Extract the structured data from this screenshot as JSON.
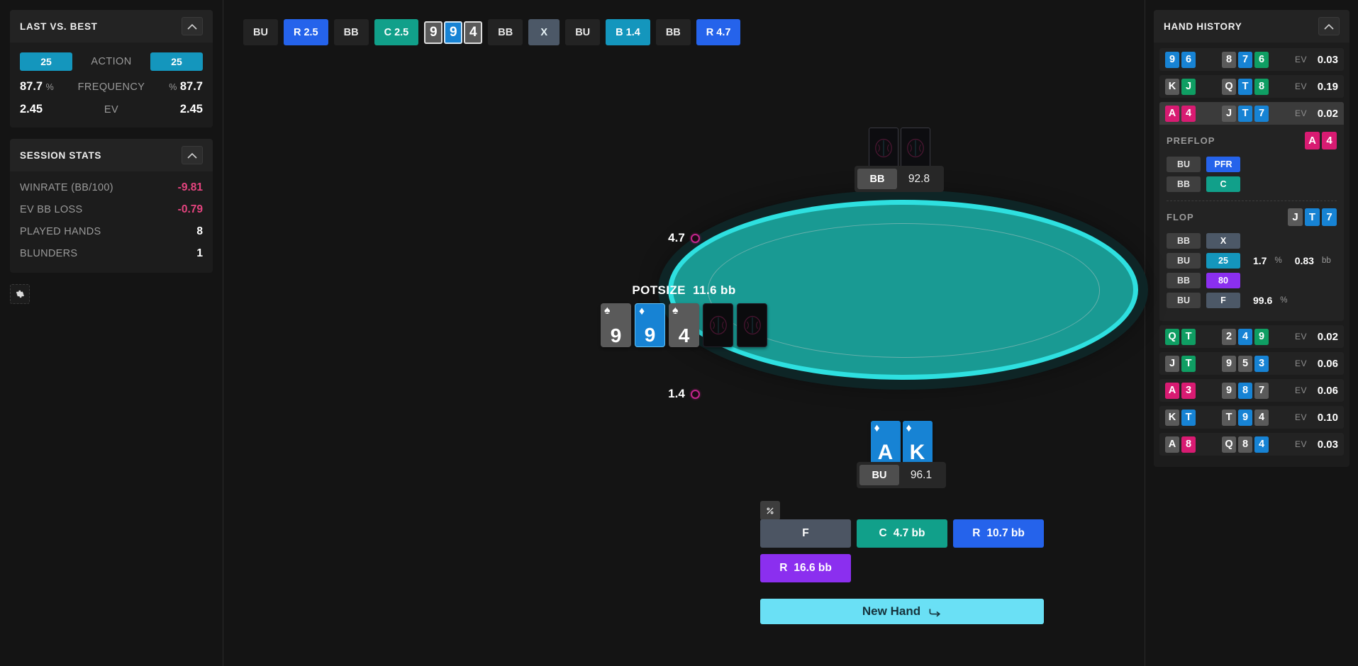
{
  "left_sidebar": {
    "last_vs_best": {
      "title": "LAST VS. BEST",
      "collapse_icon": "chevron-up-icon",
      "action_label": "ACTION",
      "action_left": "25",
      "action_right": "25",
      "frequency_label": "FREQUENCY",
      "frequency_left": "87.7",
      "frequency_left_unit": "%",
      "frequency_right": "87.7",
      "frequency_right_unit": "%",
      "ev_label": "EV",
      "ev_left": "2.45",
      "ev_right": "2.45"
    },
    "session_stats": {
      "title": "SESSION STATS",
      "collapse_icon": "chevron-up-icon",
      "rows": [
        {
          "label": "WINRATE (BB/100)",
          "value": "-9.81",
          "negative": true
        },
        {
          "label": "EV BB LOSS",
          "value": "-0.79",
          "negative": true
        },
        {
          "label": "PLAYED HANDS",
          "value": "8",
          "negative": false
        },
        {
          "label": "BLUNDERS",
          "value": "1",
          "negative": false
        }
      ]
    },
    "settings_icon": "gear-icon"
  },
  "action_strip": [
    {
      "kind": "pos",
      "label": "BU"
    },
    {
      "kind": "raise",
      "label": "R 2.5"
    },
    {
      "kind": "pos",
      "label": "BB"
    },
    {
      "kind": "call",
      "label": "C 2.5"
    },
    {
      "kind": "cards",
      "cards": [
        {
          "rank": "9",
          "suit": "s"
        },
        {
          "rank": "9",
          "suit": "d"
        },
        {
          "rank": "4",
          "suit": "s"
        }
      ]
    },
    {
      "kind": "pos",
      "label": "BB"
    },
    {
      "kind": "check",
      "label": "X"
    },
    {
      "kind": "pos",
      "label": "BU"
    },
    {
      "kind": "bet",
      "label": "B 1.4"
    },
    {
      "kind": "pos",
      "label": "BB"
    },
    {
      "kind": "raise",
      "label": "R 4.7"
    }
  ],
  "table": {
    "potsize_label": "POTSIZE",
    "potsize_value": "11.6 bb",
    "board": [
      {
        "rank": "9",
        "suit": "s",
        "facedown": false
      },
      {
        "rank": "9",
        "suit": "d",
        "facedown": false
      },
      {
        "rank": "4",
        "suit": "s",
        "facedown": false
      },
      {
        "rank": "",
        "suit": "",
        "facedown": true
      },
      {
        "rank": "",
        "suit": "",
        "facedown": true
      }
    ],
    "bet_top": "4.7",
    "bet_bottom": "1.4",
    "chip_color": "#c3248c",
    "felt_color": "#199a93",
    "rail_color": "#2ee0e0",
    "opponent": {
      "position": "BB",
      "stack": "92.8",
      "cards_facedown": true
    },
    "hero": {
      "position": "BU",
      "stack": "96.1",
      "cards": [
        {
          "rank": "A",
          "suit": "d"
        },
        {
          "rank": "K",
          "suit": "d"
        }
      ]
    }
  },
  "action_buttons": {
    "pct_toggle_label": "%",
    "pct_toggle_icon": "percent-icon",
    "row1": [
      {
        "action": "F",
        "amount": "",
        "style": "fold"
      },
      {
        "action": "C",
        "amount": "4.7 bb",
        "style": "call"
      },
      {
        "action": "R",
        "amount": "10.7 bb",
        "style": "raise"
      }
    ],
    "row2": [
      {
        "action": "R",
        "amount": "16.6 bb",
        "style": "allin"
      }
    ],
    "new_hand_label": "New Hand",
    "new_hand_icon": "redo-arrow-icon"
  },
  "hand_history": {
    "title": "HAND HISTORY",
    "collapse_icon": "chevron-up-icon",
    "ev_label": "EV",
    "rows": [
      {
        "hole": [
          {
            "rank": "9",
            "suit": "d"
          },
          {
            "rank": "6",
            "suit": "d"
          }
        ],
        "board": [
          {
            "rank": "8",
            "suit": "s"
          },
          {
            "rank": "7",
            "suit": "d"
          },
          {
            "rank": "6",
            "suit": "c"
          }
        ],
        "ev": "0.03",
        "active": false
      },
      {
        "hole": [
          {
            "rank": "K",
            "suit": "s"
          },
          {
            "rank": "J",
            "suit": "c"
          }
        ],
        "board": [
          {
            "rank": "Q",
            "suit": "s"
          },
          {
            "rank": "T",
            "suit": "d"
          },
          {
            "rank": "8",
            "suit": "c"
          }
        ],
        "ev": "0.19",
        "active": false
      },
      {
        "hole": [
          {
            "rank": "A",
            "suit": "h"
          },
          {
            "rank": "4",
            "suit": "h"
          }
        ],
        "board": [
          {
            "rank": "J",
            "suit": "s"
          },
          {
            "rank": "T",
            "suit": "d"
          },
          {
            "rank": "7",
            "suit": "d"
          }
        ],
        "ev": "0.02",
        "active": true
      },
      {
        "hole": [
          {
            "rank": "Q",
            "suit": "c"
          },
          {
            "rank": "T",
            "suit": "c"
          }
        ],
        "board": [
          {
            "rank": "2",
            "suit": "s"
          },
          {
            "rank": "4",
            "suit": "d"
          },
          {
            "rank": "9",
            "suit": "c"
          }
        ],
        "ev": "0.02",
        "active": false
      },
      {
        "hole": [
          {
            "rank": "J",
            "suit": "s"
          },
          {
            "rank": "T",
            "suit": "c"
          }
        ],
        "board": [
          {
            "rank": "9",
            "suit": "s"
          },
          {
            "rank": "5",
            "suit": "s"
          },
          {
            "rank": "3",
            "suit": "d"
          }
        ],
        "ev": "0.06",
        "active": false
      },
      {
        "hole": [
          {
            "rank": "A",
            "suit": "h"
          },
          {
            "rank": "3",
            "suit": "h"
          }
        ],
        "board": [
          {
            "rank": "9",
            "suit": "s"
          },
          {
            "rank": "8",
            "suit": "d"
          },
          {
            "rank": "7",
            "suit": "s"
          }
        ],
        "ev": "0.06",
        "active": false
      },
      {
        "hole": [
          {
            "rank": "K",
            "suit": "s"
          },
          {
            "rank": "T",
            "suit": "d"
          }
        ],
        "board": [
          {
            "rank": "T",
            "suit": "s"
          },
          {
            "rank": "9",
            "suit": "d"
          },
          {
            "rank": "4",
            "suit": "s"
          }
        ],
        "ev": "0.10",
        "active": false
      },
      {
        "hole": [
          {
            "rank": "A",
            "suit": "s"
          },
          {
            "rank": "8",
            "suit": "h"
          }
        ],
        "board": [
          {
            "rank": "Q",
            "suit": "s"
          },
          {
            "rank": "8",
            "suit": "s"
          },
          {
            "rank": "4",
            "suit": "d"
          }
        ],
        "ev": "0.03",
        "active": false
      }
    ],
    "detail": {
      "streets": [
        {
          "name": "PREFLOP",
          "cards": [
            {
              "rank": "A",
              "suit": "h"
            },
            {
              "rank": "4",
              "suit": "h"
            }
          ],
          "actions": [
            {
              "pos": "BU",
              "act": "PFR",
              "style": "a-pfr",
              "pct": "",
              "pct_unit": "",
              "bb": "",
              "bb_unit": ""
            },
            {
              "pos": "BB",
              "act": "C",
              "style": "a-c",
              "pct": "",
              "pct_unit": "",
              "bb": "",
              "bb_unit": ""
            }
          ]
        },
        {
          "name": "FLOP",
          "cards": [
            {
              "rank": "J",
              "suit": "s"
            },
            {
              "rank": "T",
              "suit": "d"
            },
            {
              "rank": "7",
              "suit": "d"
            }
          ],
          "actions": [
            {
              "pos": "BB",
              "act": "X",
              "style": "a-x",
              "pct": "",
              "pct_unit": "",
              "bb": "",
              "bb_unit": ""
            },
            {
              "pos": "BU",
              "act": "25",
              "style": "a-25",
              "pct": "1.7",
              "pct_unit": "%",
              "bb": "0.83",
              "bb_unit": "bb"
            },
            {
              "pos": "BB",
              "act": "80",
              "style": "a-80",
              "pct": "",
              "pct_unit": "",
              "bb": "",
              "bb_unit": ""
            },
            {
              "pos": "BU",
              "act": "F",
              "style": "a-f",
              "pct": "99.6",
              "pct_unit": "%",
              "bb": "",
              "bb_unit": ""
            }
          ]
        }
      ]
    }
  },
  "suit_colors": {
    "s": "#5a5a5a",
    "d": "#1783d4",
    "c": "#0f9e63",
    "h": "#d81b72"
  },
  "suit_glyphs": {
    "s": "♠",
    "d": "♦",
    "c": "♣",
    "h": "♥"
  }
}
